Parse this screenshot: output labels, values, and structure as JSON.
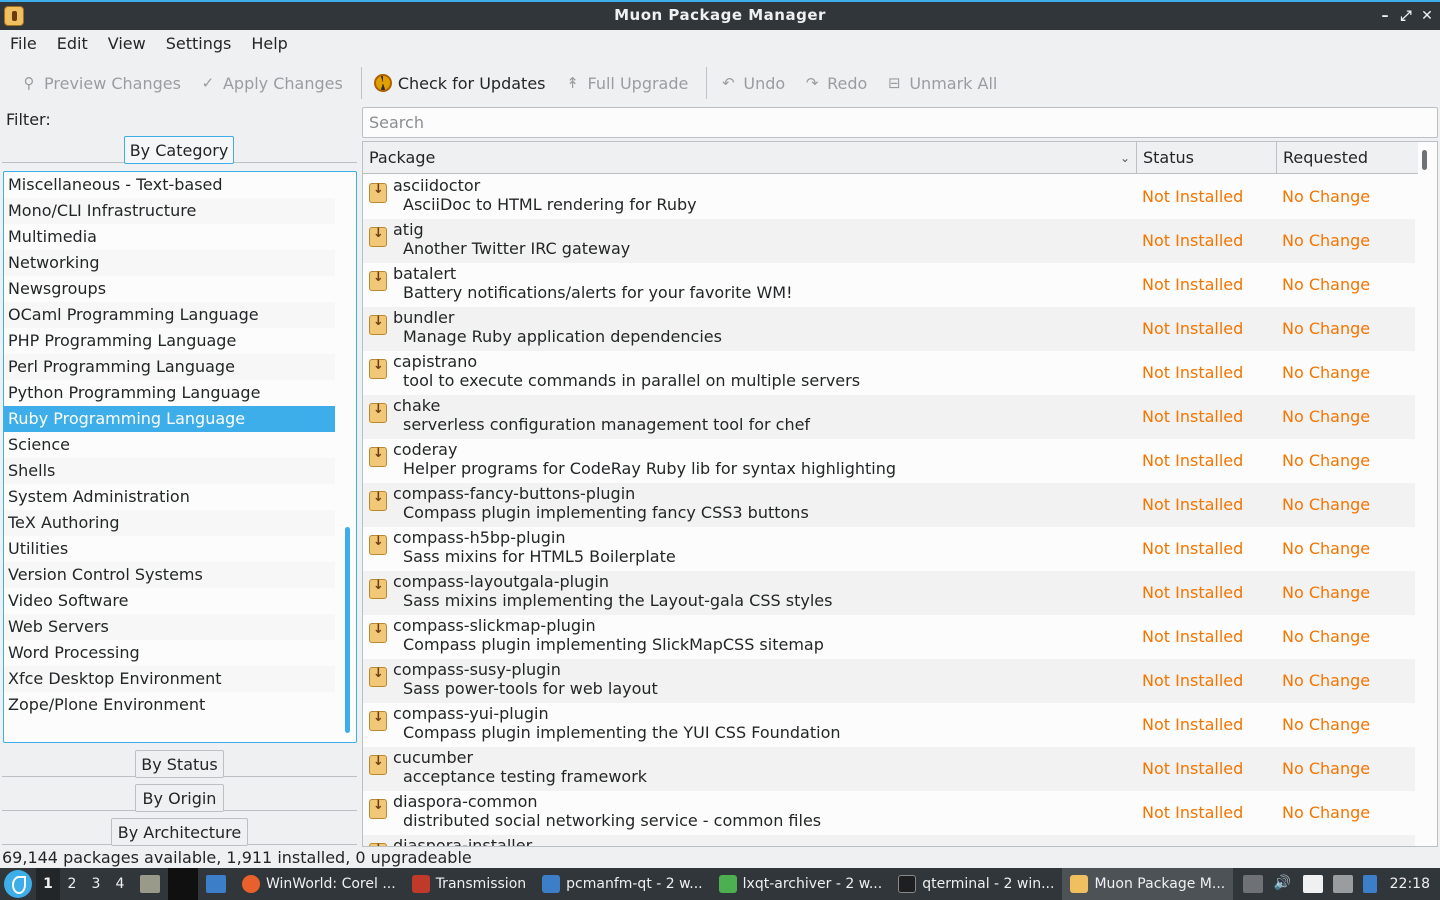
{
  "window": {
    "title": "Muon Package Manager",
    "minimize": "–",
    "maximize": "⤢",
    "close": "✕"
  },
  "menu": [
    "File",
    "Edit",
    "View",
    "Settings",
    "Help"
  ],
  "toolbar": {
    "preview": "Preview Changes",
    "apply": "Apply Changes",
    "check_updates": "Check for Updates",
    "full_upgrade": "Full Upgrade",
    "undo": "Undo",
    "redo": "Redo",
    "unmark_all": "Unmark All"
  },
  "filter": {
    "label": "Filter:",
    "by_category": "By Category",
    "by_status": "By Status",
    "by_origin": "By Origin",
    "by_architecture": "By Architecture",
    "categories": [
      "Miscellaneous - Text-based",
      "Mono/CLI Infrastructure",
      "Multimedia",
      "Networking",
      "Newsgroups",
      "OCaml Programming Language",
      "PHP Programming Language",
      "Perl Programming Language",
      "Python Programming Language",
      "Ruby Programming Language",
      "Science",
      "Shells",
      "System Administration",
      "TeX Authoring",
      "Utilities",
      "Version Control Systems",
      "Video Software",
      "Web Servers",
      "Word Processing",
      "Xfce Desktop Environment",
      "Zope/Plone Environment"
    ],
    "selected": "Ruby Programming Language"
  },
  "search": {
    "placeholder": "Search"
  },
  "table": {
    "headers": {
      "package": "Package",
      "status": "Status",
      "requested": "Requested"
    },
    "rows": [
      {
        "name": "asciidoctor",
        "desc": "AsciiDoc to HTML rendering for Ruby",
        "status": "Not Installed",
        "requested": "No Change"
      },
      {
        "name": "atig",
        "desc": "Another Twitter IRC gateway",
        "status": "Not Installed",
        "requested": "No Change"
      },
      {
        "name": "batalert",
        "desc": "Battery notifications/alerts for your favorite WM!",
        "status": "Not Installed",
        "requested": "No Change"
      },
      {
        "name": "bundler",
        "desc": "Manage Ruby application dependencies",
        "status": "Not Installed",
        "requested": "No Change"
      },
      {
        "name": "capistrano",
        "desc": "tool to execute commands in parallel on multiple servers",
        "status": "Not Installed",
        "requested": "No Change"
      },
      {
        "name": "chake",
        "desc": "serverless configuration management tool for chef",
        "status": "Not Installed",
        "requested": "No Change"
      },
      {
        "name": "coderay",
        "desc": "Helper programs for CodeRay Ruby lib for syntax highlighting",
        "status": "Not Installed",
        "requested": "No Change"
      },
      {
        "name": "compass-fancy-buttons-plugin",
        "desc": "Compass plugin implementing fancy CSS3 buttons",
        "status": "Not Installed",
        "requested": "No Change"
      },
      {
        "name": "compass-h5bp-plugin",
        "desc": "Sass mixins for HTML5 Boilerplate",
        "status": "Not Installed",
        "requested": "No Change"
      },
      {
        "name": "compass-layoutgala-plugin",
        "desc": "Sass mixins implementing the Layout-gala CSS styles",
        "status": "Not Installed",
        "requested": "No Change"
      },
      {
        "name": "compass-slickmap-plugin",
        "desc": "Compass plugin implementing SlickMapCSS sitemap",
        "status": "Not Installed",
        "requested": "No Change"
      },
      {
        "name": "compass-susy-plugin",
        "desc": "Sass power-tools for web layout",
        "status": "Not Installed",
        "requested": "No Change"
      },
      {
        "name": "compass-yui-plugin",
        "desc": "Compass plugin implementing the YUI CSS Foundation",
        "status": "Not Installed",
        "requested": "No Change"
      },
      {
        "name": "cucumber",
        "desc": "acceptance testing framework",
        "status": "Not Installed",
        "requested": "No Change"
      },
      {
        "name": "diaspora-common",
        "desc": "distributed social networking service - common files",
        "status": "Not Installed",
        "requested": "No Change"
      },
      {
        "name": "diaspora-installer",
        "desc": "",
        "status": "",
        "requested": ""
      }
    ]
  },
  "statusbar": "69,144 packages available, 1,911 installed, 0 upgradeable",
  "taskbar": {
    "workspaces": [
      "1",
      "2",
      "3",
      "4"
    ],
    "tasks": [
      {
        "label": "WinWorld: Corel ...",
        "color": "#e8602c"
      },
      {
        "label": "Transmission",
        "color": "#c0392b"
      },
      {
        "label": "pcmanfm-qt - 2 w...",
        "color": "#3d7ec9"
      },
      {
        "label": "lxqt-archiver - 2 w...",
        "color": "#4caf50"
      },
      {
        "label": "qterminal - 2 win...",
        "color": "#1d1f21"
      },
      {
        "label": "Muon Package M...",
        "color": "#f0c060"
      }
    ],
    "clock": "22:18"
  },
  "colors": {
    "accent": "#3daee9",
    "status_orange": "#f67400",
    "titlebar_bg": "#31363b"
  }
}
